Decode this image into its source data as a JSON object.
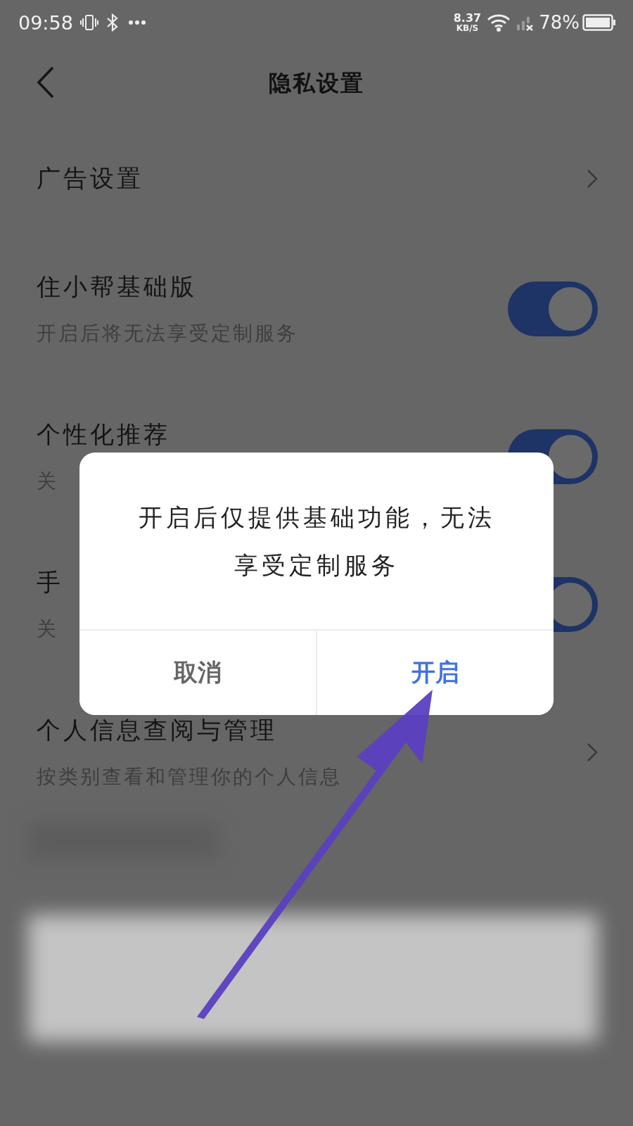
{
  "status_bar": {
    "time": "09:58",
    "speed": "8.37",
    "speed_unit": "KB/S",
    "battery": "78%"
  },
  "header": {
    "title": "隐私设置"
  },
  "rows": [
    {
      "kind": "link",
      "title": "广告设置"
    },
    {
      "kind": "toggle",
      "title": "住小帮基础版",
      "subtitle": "开启后将无法享受定制服务",
      "on": true
    },
    {
      "kind": "toggle",
      "title": "个性化推荐",
      "subtitle": "关",
      "on": true
    },
    {
      "kind": "toggle",
      "title": "手",
      "subtitle": "关",
      "on": true
    },
    {
      "kind": "link",
      "title": "个人信息查阅与管理",
      "subtitle": "按类别查看和管理你的个人信息"
    }
  ],
  "dialog": {
    "message": "开启后仅提供基础功能，无法享受定制服务",
    "buttons": [
      {
        "label": "取消",
        "primary": false
      },
      {
        "label": "开启",
        "primary": true
      }
    ]
  }
}
